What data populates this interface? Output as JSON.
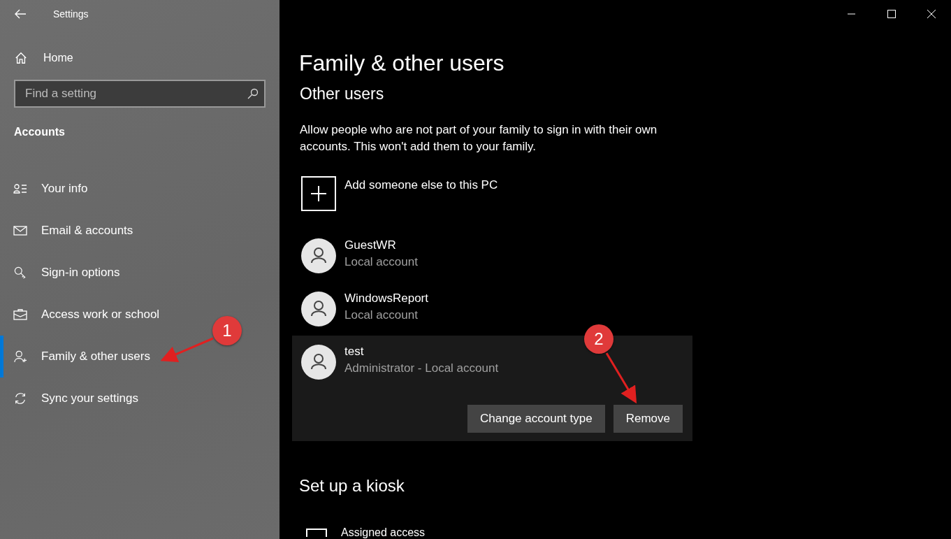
{
  "window": {
    "title": "Settings"
  },
  "sidebar": {
    "home": "Home",
    "search": {
      "placeholder": "Find a setting"
    },
    "section": "Accounts",
    "items": [
      {
        "label": "Your info",
        "kind": "info",
        "selected": false
      },
      {
        "label": "Email & accounts",
        "kind": "mail",
        "selected": false
      },
      {
        "label": "Sign-in options",
        "kind": "key",
        "selected": false
      },
      {
        "label": "Access work or school",
        "kind": "briefcase",
        "selected": false
      },
      {
        "label": "Family & other users",
        "kind": "person-add",
        "selected": true
      },
      {
        "label": "Sync your settings",
        "kind": "sync",
        "selected": false
      }
    ]
  },
  "main": {
    "title": "Family & other users",
    "heading": "Other users",
    "description": "Allow people who are not part of your family to sign in with their own accounts. This won't add them to your family.",
    "add_label": "Add someone else to this PC",
    "users": [
      {
        "name": "GuestWR",
        "detail": "Local account",
        "expanded": false
      },
      {
        "name": "WindowsReport",
        "detail": "Local account",
        "expanded": false
      },
      {
        "name": "test",
        "detail": "Administrator - Local account",
        "expanded": true
      }
    ],
    "user_buttons": [
      "Change account type",
      "Remove"
    ],
    "kiosk_heading": "Set up a kiosk",
    "kiosk_item": "Assigned access"
  },
  "annotations": [
    {
      "number": "1"
    },
    {
      "number": "2"
    }
  ]
}
